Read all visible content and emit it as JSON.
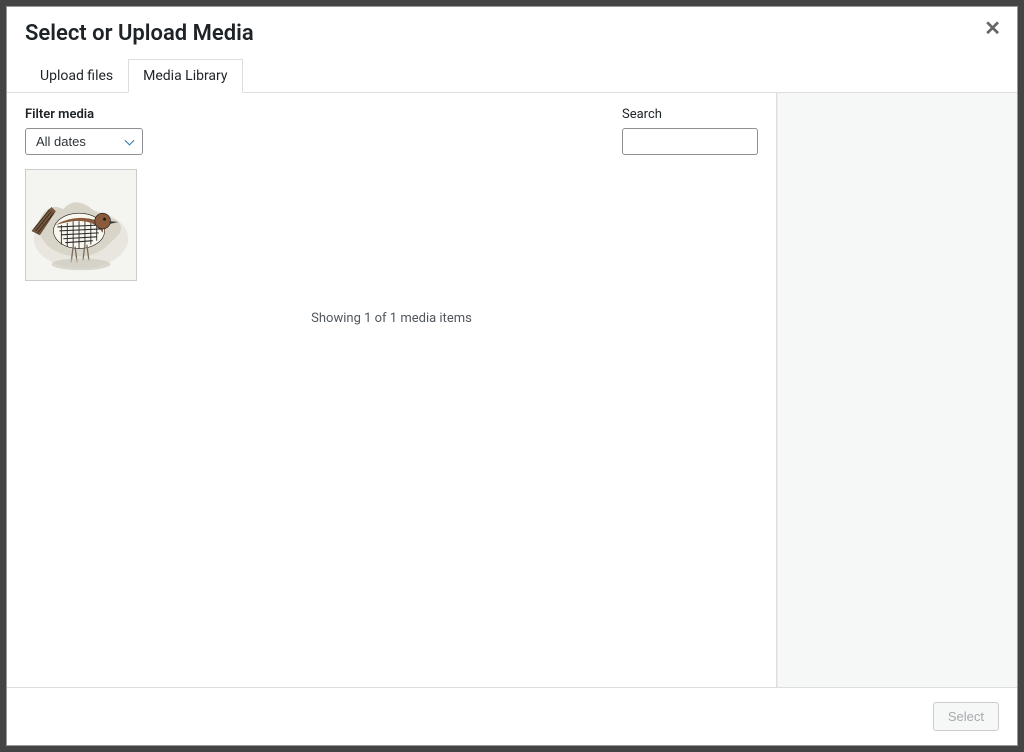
{
  "modal": {
    "title": "Select or Upload Media",
    "close_glyph": "✕"
  },
  "tabs": {
    "upload": "Upload files",
    "library": "Media Library"
  },
  "filter": {
    "label": "Filter media",
    "selected": "All dates"
  },
  "search": {
    "label": "Search",
    "value": ""
  },
  "status": "Showing 1 of 1 media items",
  "footer": {
    "select_label": "Select"
  }
}
